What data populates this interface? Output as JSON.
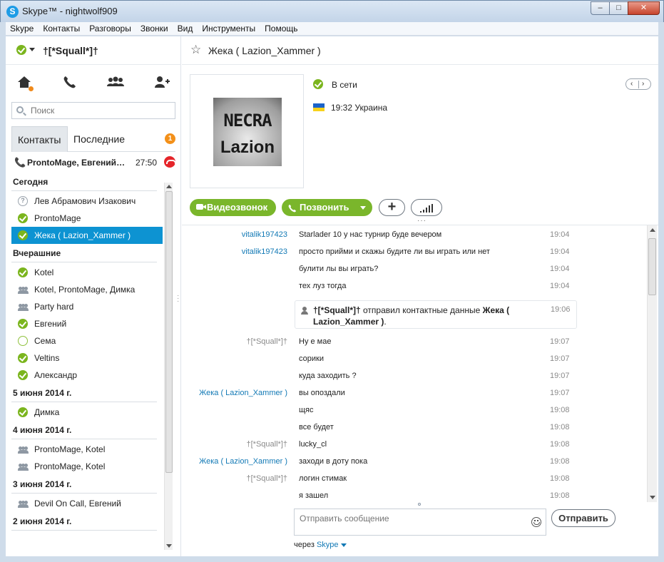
{
  "window": {
    "title": "Skype™ - nightwolf909",
    "minimize": "–",
    "maximize": "□",
    "close": "✕"
  },
  "menu": [
    "Skype",
    "Контакты",
    "Разговоры",
    "Звонки",
    "Вид",
    "Инструменты",
    "Помощь"
  ],
  "me": {
    "name": "†[*Squall*]†",
    "status": "online"
  },
  "search": {
    "placeholder": "Поиск"
  },
  "tabs": {
    "contacts": "Контакты",
    "recent": "Последние",
    "badge": "1"
  },
  "active_call": {
    "name": "ProntoMage, Евгений, Котел",
    "duration": "27:50"
  },
  "groups": [
    {
      "label": "Сегодня",
      "items": [
        {
          "name": "Лев Абрамович Изакович",
          "icon": "unknown"
        },
        {
          "name": "ProntoMage",
          "icon": "online"
        },
        {
          "name": "Жека ( Lazion_Xammer )",
          "icon": "online",
          "selected": true
        }
      ]
    },
    {
      "label": "Вчерашние",
      "items": [
        {
          "name": "Kotel",
          "icon": "online"
        },
        {
          "name": "Kotel, ProntoMage, Димка",
          "icon": "group"
        },
        {
          "name": "Party hard",
          "icon": "group"
        },
        {
          "name": "Евгений",
          "icon": "online"
        },
        {
          "name": "Сема",
          "icon": "offline"
        },
        {
          "name": "Veltins",
          "icon": "online"
        },
        {
          "name": "Александр",
          "icon": "online"
        }
      ]
    },
    {
      "label": "5 июня 2014 г.",
      "items": [
        {
          "name": "Димка",
          "icon": "online"
        }
      ]
    },
    {
      "label": "4 июня 2014 г.",
      "items": [
        {
          "name": "ProntoMage, Kotel",
          "icon": "group"
        },
        {
          "name": "ProntoMage, Kotel",
          "icon": "group"
        }
      ]
    },
    {
      "label": "3 июня 2014 г.",
      "items": [
        {
          "name": "Devil On Call, Евгений",
          "icon": "group"
        }
      ]
    },
    {
      "label": "2 июня 2014 г.",
      "items": []
    }
  ],
  "conversation": {
    "title": "Жека ( Lazion_Xammer )",
    "avatar_top": "NECRA",
    "avatar_bottom": "Lazion",
    "presence": "В сети",
    "local_time": "19:32 Украина",
    "pager_prev": "‹",
    "pager_next": "›",
    "video_call": "Видеозвонок",
    "call": "Позвонить",
    "add": "+"
  },
  "messages": [
    {
      "sender": "vitalik197423",
      "sender_style": "blue",
      "text": "Starlader 10  у нас турнир буде вечером",
      "time": "19:04"
    },
    {
      "sender": "vitalik197423",
      "sender_style": "blue",
      "text": "просто прийми и скажы будите ли вы играть или нет",
      "time": "19:04"
    },
    {
      "sender": "",
      "sender_style": "blue",
      "text": "булити лы вы играть?",
      "time": "19:04"
    },
    {
      "sender": "",
      "sender_style": "blue",
      "text": "тех луз тогда",
      "time": "19:04"
    },
    {
      "sender": "†[*Squall*]†",
      "sender_style": "grey",
      "text": "Ну е мае",
      "time": "19:07"
    },
    {
      "sender": "",
      "sender_style": "grey",
      "text": "сорики",
      "time": "19:07"
    },
    {
      "sender": "",
      "sender_style": "grey",
      "text": "куда заходить ?",
      "time": "19:07"
    },
    {
      "sender": "Жека ( Lazion_Xammer )",
      "sender_style": "blue",
      "text": "вы опоздали",
      "time": "19:07"
    },
    {
      "sender": "",
      "sender_style": "blue",
      "text": "щяс",
      "time": "19:08"
    },
    {
      "sender": "",
      "sender_style": "blue",
      "text": "все будет",
      "time": "19:08"
    },
    {
      "sender": "†[*Squall*]†",
      "sender_style": "grey",
      "text": "lucky_cl",
      "time": "19:08"
    },
    {
      "sender": "Жека ( Lazion_Xammer )",
      "sender_style": "blue",
      "text": "заходи в доту пока",
      "time": "19:08"
    },
    {
      "sender": "†[*Squall*]†",
      "sender_style": "grey",
      "text": "логин стимак",
      "time": "19:08"
    },
    {
      "sender": "",
      "sender_style": "grey",
      "text": "я зашел",
      "time": "19:08"
    }
  ],
  "system_message": {
    "sender": "†[*Squall*]†",
    "middle": " отправил контактные данные ",
    "contact": "Жека ( Lazion_Xammer )",
    "end": ".",
    "time": "19:06"
  },
  "compose": {
    "placeholder": "Отправить сообщение",
    "send": "Отправить",
    "via": "через",
    "via_link": "Skype"
  },
  "colors": {
    "accent_blue": "#0d93d2",
    "skype_green": "#7ab62b",
    "badge_orange": "#f39019"
  }
}
